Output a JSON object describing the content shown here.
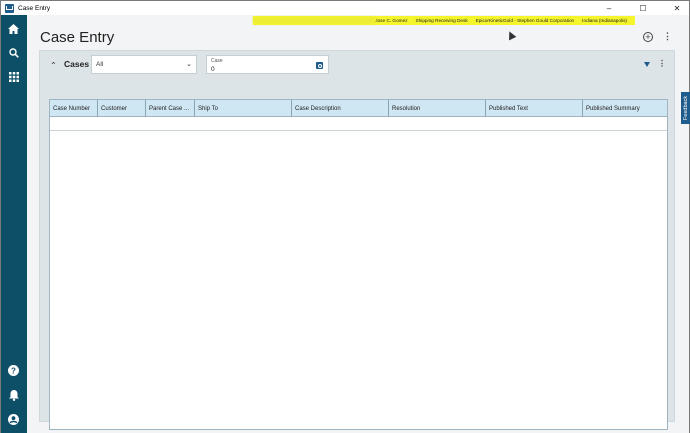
{
  "window": {
    "title": "Case Entry",
    "controls": [
      "–",
      "☐",
      "✕"
    ]
  },
  "sidebar": {
    "icons": [
      "home-icon",
      "search-icon",
      "apps-grid-icon",
      "help-icon",
      "notifications-icon",
      "account-icon"
    ]
  },
  "userbar": {
    "user": "Jose C. Gomez",
    "workstation": "Shipping Receiving Desk",
    "company": "EpicorKineticGold - Stephen Gould Corporation",
    "site": "Indiana (Indianapolis)"
  },
  "page": {
    "title": "Case Entry"
  },
  "panel": {
    "title": "Cases",
    "filter_value": "All",
    "case_label": "Case",
    "case_value": "0"
  },
  "grid": {
    "columns": [
      "Case Number",
      "Customer",
      "Parent Case ...",
      "Ship To",
      "Case Description",
      "Resolution",
      "Published Text",
      "Published Summary"
    ]
  },
  "feedback_label": "Feedback",
  "colors": {
    "sidebar": "#0e4f68",
    "accent": "#1f5b8b",
    "highlight": "#f5f52c",
    "grid_header": "#cfe6f3"
  }
}
